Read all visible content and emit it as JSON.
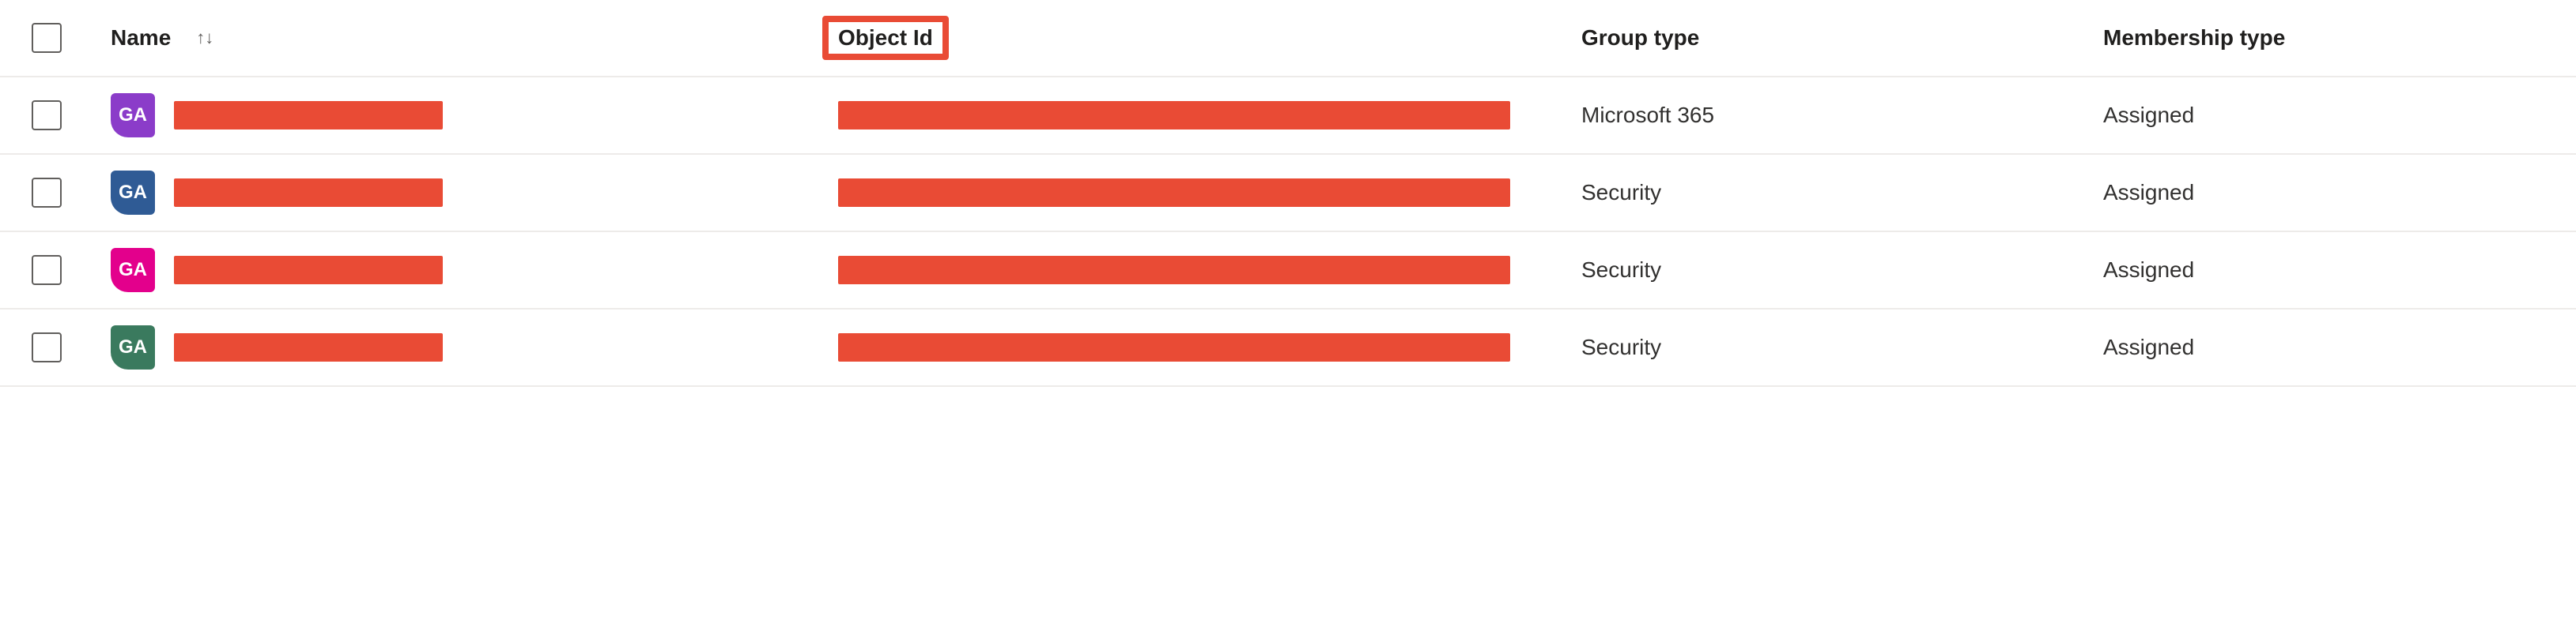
{
  "columns": {
    "name": "Name",
    "objectId": "Object Id",
    "groupType": "Group type",
    "membershipType": "Membership type"
  },
  "rows": [
    {
      "avatar": "GA",
      "avatarColor": "#8b3cc9",
      "groupType": "Microsoft 365",
      "membershipType": "Assigned"
    },
    {
      "avatar": "GA",
      "avatarColor": "#2f5b95",
      "groupType": "Security",
      "membershipType": "Assigned"
    },
    {
      "avatar": "GA",
      "avatarColor": "#e3008c",
      "groupType": "Security",
      "membershipType": "Assigned"
    },
    {
      "avatar": "GA",
      "avatarColor": "#3a7a5e",
      "groupType": "Security",
      "membershipType": "Assigned"
    }
  ],
  "redactionColor": "#e94b35"
}
